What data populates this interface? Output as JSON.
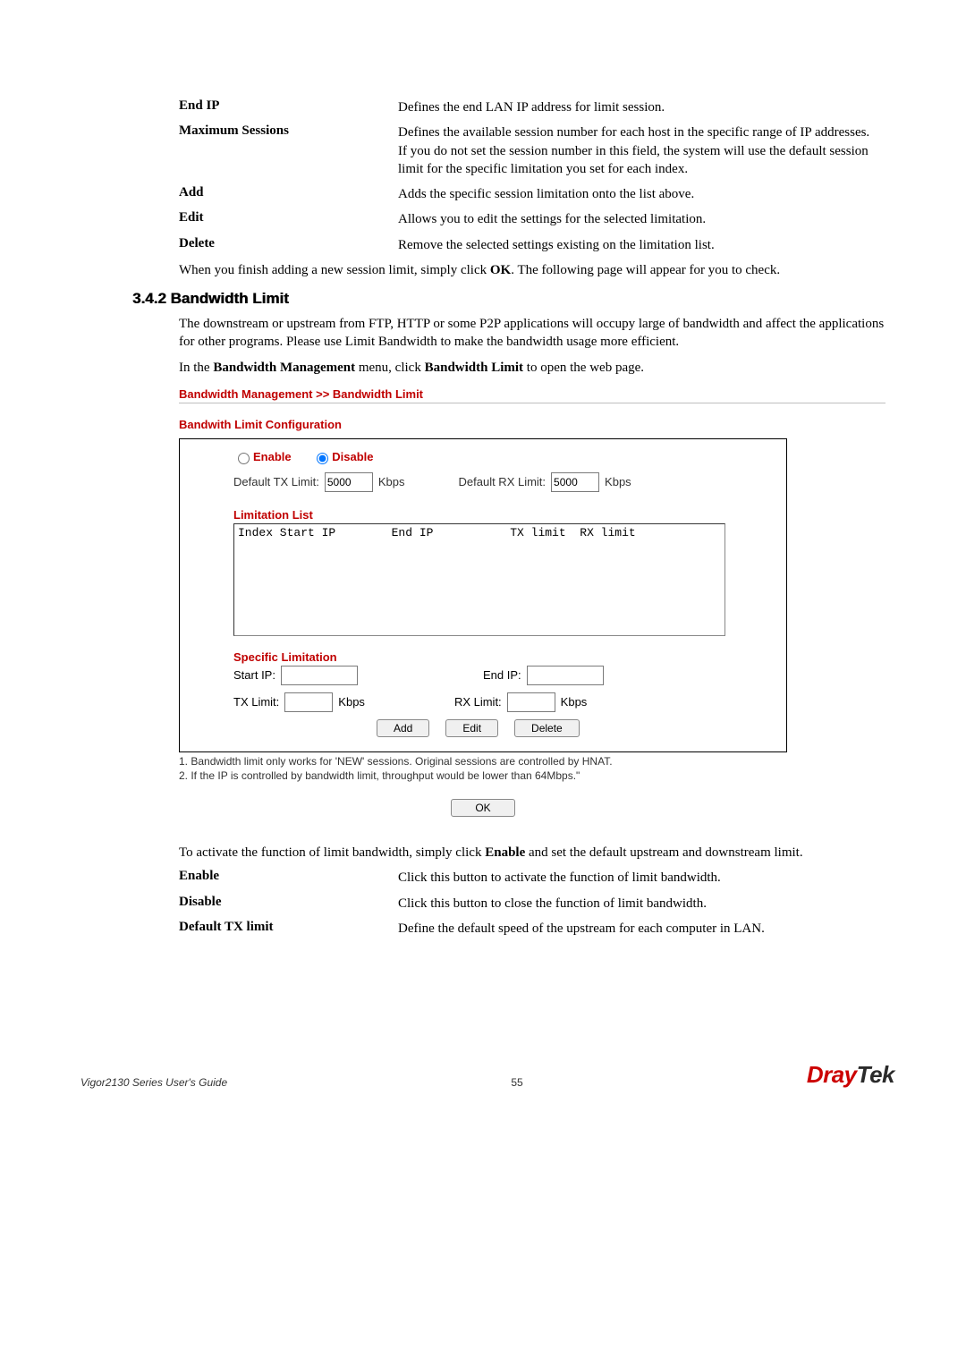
{
  "defs": {
    "end_ip": {
      "term": "End IP",
      "desc": "Defines the end LAN IP address for limit session."
    },
    "max_sessions": {
      "term": "Maximum Sessions",
      "desc": "Defines the available session number for each host in the specific range of IP addresses. If you do not set the session number in this field, the system will use the default session limit for the specific limitation you set for each index."
    },
    "add": {
      "term": "Add",
      "desc": "Adds the specific session limitation onto the list above."
    },
    "edit": {
      "term": "Edit",
      "desc": "Allows you to edit the settings for the selected limitation."
    },
    "delete": {
      "term": "Delete",
      "desc": "Remove the selected settings existing on the limitation list."
    }
  },
  "after_defs_1": "When you finish adding a new session limit, simply click ",
  "after_defs_bold": "OK",
  "after_defs_2": ". The following page will appear for you to check.",
  "section_number": "3.4.2 Bandwidth Limit",
  "intro_para": "The downstream or upstream from FTP, HTTP or some P2P applications will occupy large of bandwidth and affect the applications for other programs. Please use Limit Bandwidth to make the bandwidth usage more efficient.",
  "open_para_1": "In the ",
  "open_para_bold1": "Bandwidth Management",
  "open_para_2": " menu, click ",
  "open_para_bold2": "Bandwidth Limit",
  "open_para_3": " to open the web page.",
  "ss": {
    "crumb": "Bandwidth Management >> Bandwidth Limit",
    "config_title": "Bandwith Limit Configuration",
    "enable_label": "Enable",
    "disable_label": "Disable",
    "default_tx_label": "Default TX Limit:",
    "default_tx_value": "5000",
    "default_tx_unit": "Kbps",
    "default_rx_label": "Default RX Limit:",
    "default_rx_value": "5000",
    "default_rx_unit": "Kbps",
    "limitation_list_label": "Limitation List",
    "list_header": "Index Start IP        End IP           TX limit  RX limit",
    "specific_limitation_label": "Specific Limitation",
    "start_ip_label": "Start IP:",
    "end_ip_label": "End IP:",
    "tx_limit_label": "TX Limit:",
    "tx_limit_unit": "Kbps",
    "rx_limit_label": "RX Limit:",
    "rx_limit_unit": "Kbps",
    "btn_add": "Add",
    "btn_edit": "Edit",
    "btn_delete": "Delete",
    "btn_ok": "OK"
  },
  "notes": {
    "n1": "1. Bandwidth limit only works for 'NEW' sessions. Original sessions are controlled by HNAT.",
    "n2": "2. If the IP is controlled by bandwidth limit, throughput would be lower than 64Mbps.\""
  },
  "activate_1": "To activate the function of limit bandwidth, simply click ",
  "activate_bold": "Enable",
  "activate_2": " and set the default upstream and downstream limit.",
  "defs2": {
    "enable": {
      "term": "Enable",
      "desc": "Click this button to activate the function of limit bandwidth."
    },
    "disable": {
      "term": "Disable",
      "desc": "Click this button to close the function of limit bandwidth."
    },
    "default_tx": {
      "term": "Default TX limit",
      "desc": "Define the default speed of the upstream for each computer in LAN."
    }
  },
  "footer": {
    "left": "Vigor2130 Series User's Guide",
    "page": "55",
    "logo_dray": "Dray",
    "logo_tek": "Tek"
  }
}
